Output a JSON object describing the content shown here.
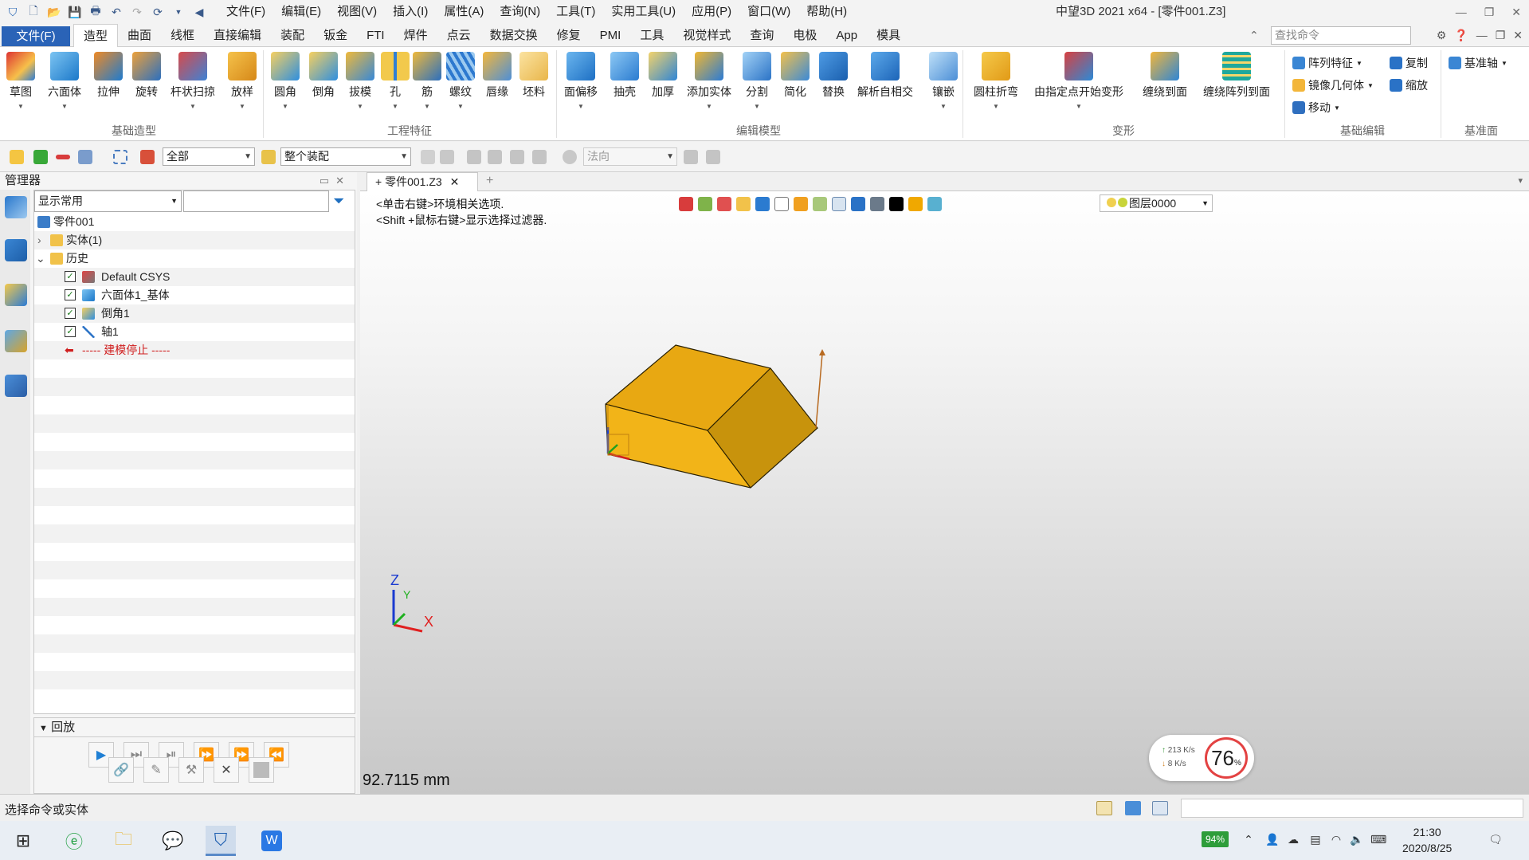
{
  "titlebar": {
    "menus": [
      "文件(F)",
      "编辑(E)",
      "视图(V)",
      "插入(I)",
      "属性(A)",
      "查询(N)",
      "工具(T)",
      "实用工具(U)",
      "应用(P)",
      "窗口(W)",
      "帮助(H)"
    ],
    "window_title": "中望3D 2021 x64 - [零件001.Z3]"
  },
  "ribbon_tabs": {
    "file": "文件(F)",
    "tabs": [
      "造型",
      "曲面",
      "线框",
      "直接编辑",
      "装配",
      "钣金",
      "FTI",
      "焊件",
      "点云",
      "数据交换",
      "修复",
      "PMI",
      "工具",
      "视觉样式",
      "查询",
      "电极",
      "App",
      "模具"
    ],
    "active": "造型",
    "search_placeholder": "查找命令"
  },
  "ribbon": {
    "groups": {
      "basic_modeling": {
        "label": "基础造型",
        "buttons": [
          "草图",
          "六面体",
          "拉伸",
          "旋转",
          "杆状扫掠",
          "放样"
        ]
      },
      "engineering": {
        "label": "工程特征",
        "buttons": [
          "圆角",
          "倒角",
          "拔模",
          "孔",
          "筋",
          "螺纹",
          "唇缘",
          "坯料"
        ]
      },
      "edit_model": {
        "label": "编辑模型",
        "buttons": [
          "面偏移",
          "抽壳",
          "加厚",
          "添加实体",
          "分割",
          "简化",
          "替换",
          "解析自相交",
          "镶嵌"
        ]
      },
      "deform": {
        "label": "变形",
        "buttons": [
          "圆柱折弯",
          "由指定点开始变形",
          "缠绕到面",
          "缠绕阵列到面"
        ]
      },
      "basic_edit": {
        "label": "基础编辑",
        "buttons": [
          "阵列特征",
          "镜像几何体",
          "移动",
          "复制",
          "缩放"
        ]
      },
      "datum": {
        "label": "基准面",
        "buttons": [
          "基准轴"
        ]
      }
    }
  },
  "toolbar2": {
    "filter_value": "全部",
    "assembly_value": "整个装配",
    "normal_value": "法向"
  },
  "manager": {
    "title": "管理器",
    "filter_value": "显示常用",
    "tree": {
      "root": "零件001",
      "solid": "实体(1)",
      "history": "历史",
      "items": [
        "Default CSYS",
        "六面体1_基体",
        "倒角1",
        "轴1"
      ],
      "stop": "----- 建模停止 -----"
    },
    "playback_title": "回放"
  },
  "viewport": {
    "doc_tab": "零件001.Z3",
    "hints": [
      "<单击右键>环境相关选项.",
      "<Shift +鼠标右键>显示选择过滤器."
    ],
    "layer": "图层0000",
    "distance": "92.7115 mm",
    "net": {
      "up": "213 K/s",
      "down": "8  K/s",
      "percent": "76",
      "percent_sign": "%"
    },
    "colors": {
      "box_top": "#E8A812",
      "box_front": "#F2B418",
      "box_side": "#C8930C"
    },
    "axis_labels": {
      "z": "Z",
      "y": "Y",
      "x": "X"
    }
  },
  "statusbar": {
    "message": "选择命令或实体"
  },
  "taskbar": {
    "battery": "94%",
    "time": "21:30",
    "date": "2020/8/25"
  }
}
